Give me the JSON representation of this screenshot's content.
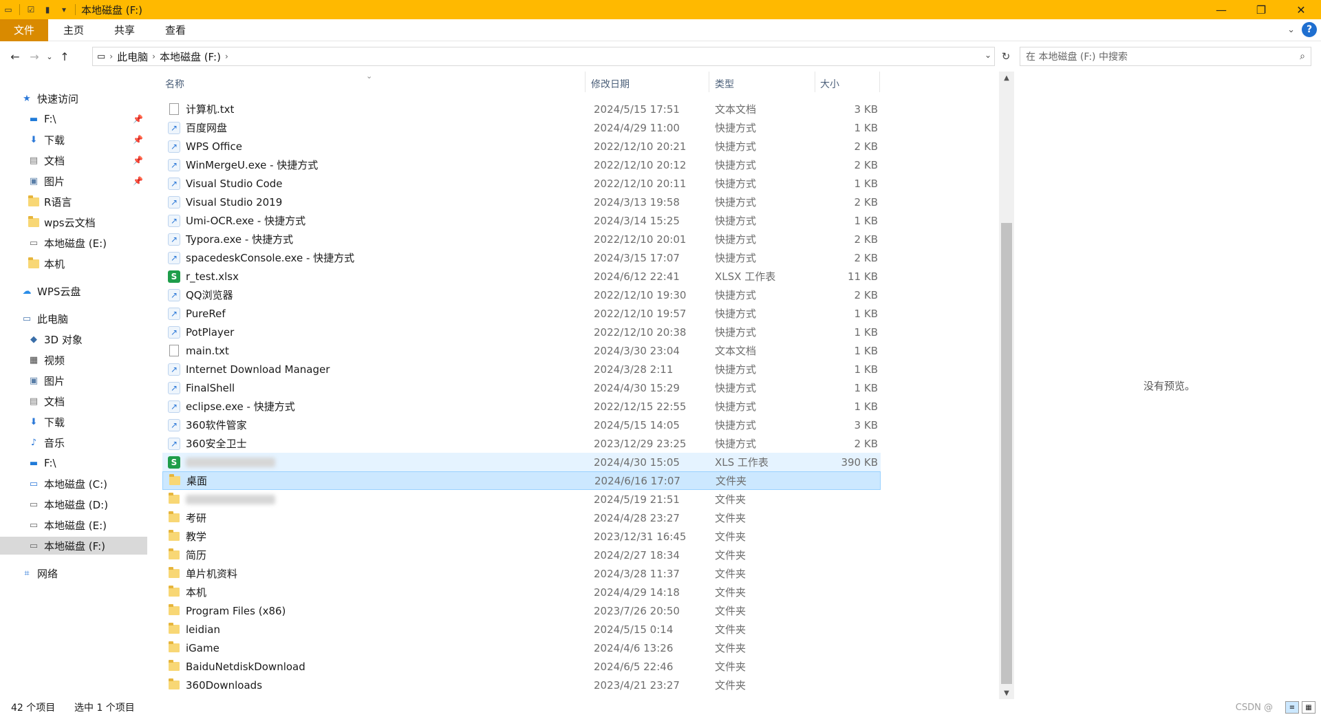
{
  "window": {
    "title": "本地磁盘 (F:)",
    "controls": {
      "minimize": "—",
      "maximize": "❐",
      "close": "✕"
    }
  },
  "ribbon": {
    "tabs": [
      "文件",
      "主页",
      "共享",
      "查看"
    ],
    "help": "?"
  },
  "address": {
    "crumbs": [
      "此电脑",
      "本地磁盘 (F:)"
    ],
    "search_placeholder": "在 本地磁盘 (F:) 中搜索"
  },
  "sidebar": {
    "items": [
      {
        "label": "快速访问",
        "icon": "star-icon"
      },
      {
        "label": "F:\\",
        "icon": "drive-icon",
        "pinned": true
      },
      {
        "label": "下载",
        "icon": "download-icon",
        "pinned": true
      },
      {
        "label": "文档",
        "icon": "document-icon",
        "pinned": true
      },
      {
        "label": "图片",
        "icon": "pictures-icon",
        "pinned": true
      },
      {
        "label": "R语言",
        "icon": "folder-icon"
      },
      {
        "label": "wps云文档",
        "icon": "folder-icon"
      },
      {
        "label": "本地磁盘 (E:)",
        "icon": "drive-icon"
      },
      {
        "label": "本机",
        "icon": "folder-icon"
      },
      {
        "label": "WPS云盘",
        "icon": "cloud-icon"
      },
      {
        "label": "此电脑",
        "icon": "computer-icon"
      },
      {
        "label": "3D 对象",
        "icon": "3d-objects-icon"
      },
      {
        "label": "视频",
        "icon": "video-icon"
      },
      {
        "label": "图片",
        "icon": "pictures-icon"
      },
      {
        "label": "文档",
        "icon": "document-icon"
      },
      {
        "label": "下载",
        "icon": "download-icon"
      },
      {
        "label": "音乐",
        "icon": "music-icon"
      },
      {
        "label": "F:\\",
        "icon": "drive-icon"
      },
      {
        "label": "本地磁盘 (C:)",
        "icon": "drive-icon"
      },
      {
        "label": "本地磁盘 (D:)",
        "icon": "drive-icon"
      },
      {
        "label": "本地磁盘 (E:)",
        "icon": "drive-icon"
      },
      {
        "label": "本地磁盘 (F:)",
        "icon": "drive-icon",
        "selected": true
      },
      {
        "label": "网络",
        "icon": "network-icon"
      }
    ]
  },
  "columns": {
    "name": "名称",
    "date": "修改日期",
    "type": "类型",
    "size": "大小"
  },
  "files": [
    {
      "name": "计算机.txt",
      "date": "2024/5/15 17:51",
      "type": "文本文档",
      "size": "3 KB",
      "icon": "text-file-icon"
    },
    {
      "name": "百度网盘",
      "date": "2024/4/29 11:00",
      "type": "快捷方式",
      "size": "1 KB",
      "icon": "shortcut-icon"
    },
    {
      "name": "WPS Office",
      "date": "2022/12/10 20:21",
      "type": "快捷方式",
      "size": "2 KB",
      "icon": "shortcut-icon"
    },
    {
      "name": "WinMergeU.exe - 快捷方式",
      "date": "2022/12/10 20:12",
      "type": "快捷方式",
      "size": "2 KB",
      "icon": "shortcut-icon"
    },
    {
      "name": "Visual Studio Code",
      "date": "2022/12/10 20:11",
      "type": "快捷方式",
      "size": "1 KB",
      "icon": "shortcut-icon"
    },
    {
      "name": "Visual Studio 2019",
      "date": "2024/3/13 19:58",
      "type": "快捷方式",
      "size": "2 KB",
      "icon": "shortcut-icon"
    },
    {
      "name": "Umi-OCR.exe - 快捷方式",
      "date": "2024/3/14 15:25",
      "type": "快捷方式",
      "size": "1 KB",
      "icon": "shortcut-icon"
    },
    {
      "name": "Typora.exe - 快捷方式",
      "date": "2022/12/10 20:01",
      "type": "快捷方式",
      "size": "2 KB",
      "icon": "shortcut-icon"
    },
    {
      "name": "spacedeskConsole.exe - 快捷方式",
      "date": "2024/3/15 17:07",
      "type": "快捷方式",
      "size": "2 KB",
      "icon": "shortcut-icon"
    },
    {
      "name": "r_test.xlsx",
      "date": "2024/6/12 22:41",
      "type": "XLSX 工作表",
      "size": "11 KB",
      "icon": "spreadsheet-icon"
    },
    {
      "name": "QQ浏览器",
      "date": "2022/12/10 19:30",
      "type": "快捷方式",
      "size": "2 KB",
      "icon": "shortcut-icon"
    },
    {
      "name": "PureRef",
      "date": "2022/12/10 19:57",
      "type": "快捷方式",
      "size": "1 KB",
      "icon": "shortcut-icon"
    },
    {
      "name": "PotPlayer",
      "date": "2022/12/10 20:38",
      "type": "快捷方式",
      "size": "1 KB",
      "icon": "shortcut-icon"
    },
    {
      "name": "main.txt",
      "date": "2024/3/30 23:04",
      "type": "文本文档",
      "size": "1 KB",
      "icon": "text-file-icon"
    },
    {
      "name": "Internet Download Manager",
      "date": "2024/3/28 2:11",
      "type": "快捷方式",
      "size": "1 KB",
      "icon": "shortcut-icon"
    },
    {
      "name": "FinalShell",
      "date": "2024/4/30 15:29",
      "type": "快捷方式",
      "size": "1 KB",
      "icon": "shortcut-icon"
    },
    {
      "name": "eclipse.exe - 快捷方式",
      "date": "2022/12/15 22:55",
      "type": "快捷方式",
      "size": "1 KB",
      "icon": "shortcut-icon"
    },
    {
      "name": "360软件管家",
      "date": "2024/5/15 14:05",
      "type": "快捷方式",
      "size": "3 KB",
      "icon": "shortcut-icon"
    },
    {
      "name": "360安全卫士",
      "date": "2023/12/29 23:25",
      "type": "快捷方式",
      "size": "2 KB",
      "icon": "shortcut-icon"
    },
    {
      "name": "",
      "date": "2024/4/30 15:05",
      "type": "XLS 工作表",
      "size": "390 KB",
      "icon": "spreadsheet-icon",
      "state": "hover",
      "blurred": true
    },
    {
      "name": "桌面",
      "date": "2024/6/16 17:07",
      "type": "文件夹",
      "size": "",
      "icon": "folder-icon",
      "state": "selected"
    },
    {
      "name": "",
      "date": "2024/5/19 21:51",
      "type": "文件夹",
      "size": "",
      "icon": "folder-icon",
      "blurred": true
    },
    {
      "name": "考研",
      "date": "2024/4/28 23:27",
      "type": "文件夹",
      "size": "",
      "icon": "folder-icon"
    },
    {
      "name": "教学",
      "date": "2023/12/31 16:45",
      "type": "文件夹",
      "size": "",
      "icon": "folder-icon"
    },
    {
      "name": "简历",
      "date": "2024/2/27 18:34",
      "type": "文件夹",
      "size": "",
      "icon": "folder-icon"
    },
    {
      "name": "单片机资料",
      "date": "2024/3/28 11:37",
      "type": "文件夹",
      "size": "",
      "icon": "folder-icon"
    },
    {
      "name": "本机",
      "date": "2024/4/29 14:18",
      "type": "文件夹",
      "size": "",
      "icon": "folder-icon"
    },
    {
      "name": "Program Files (x86)",
      "date": "2023/7/26 20:50",
      "type": "文件夹",
      "size": "",
      "icon": "folder-icon"
    },
    {
      "name": "leidian",
      "date": "2024/5/15 0:14",
      "type": "文件夹",
      "size": "",
      "icon": "folder-icon"
    },
    {
      "name": "iGame",
      "date": "2024/4/6 13:26",
      "type": "文件夹",
      "size": "",
      "icon": "folder-icon"
    },
    {
      "name": "BaiduNetdiskDownload",
      "date": "2024/6/5 22:46",
      "type": "文件夹",
      "size": "",
      "icon": "folder-icon"
    },
    {
      "name": "360Downloads",
      "date": "2023/4/21 23:27",
      "type": "文件夹",
      "size": "",
      "icon": "folder-icon"
    }
  ],
  "preview": {
    "message": "没有预览。"
  },
  "status": {
    "count": "42 个项目",
    "selected": "选中 1 个项目",
    "watermark": "CSDN @"
  },
  "colors": {
    "titlebar": "#ffb900",
    "file_tab": "#d98a00",
    "selection": "#cce8ff",
    "hover": "#e5f3ff"
  }
}
